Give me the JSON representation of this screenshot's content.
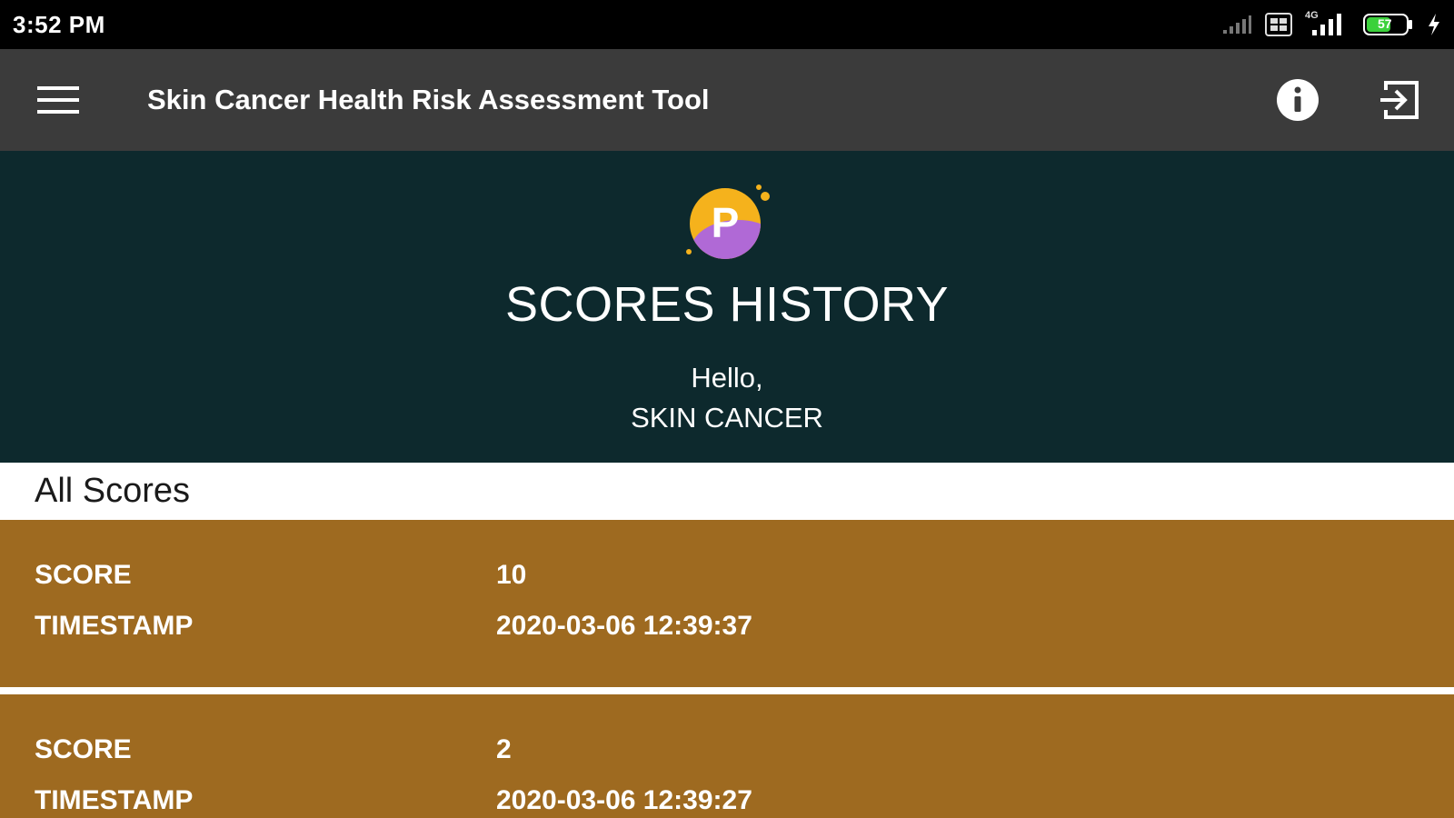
{
  "status_bar": {
    "time": "3:52 PM",
    "battery": "57",
    "network": "4G"
  },
  "app_bar": {
    "title": "Skin Cancer Health Risk Assessment Tool"
  },
  "hero": {
    "logo_letter": "P",
    "title": "SCORES HISTORY",
    "greeting": "Hello,",
    "user_name": "SKIN CANCER"
  },
  "section": {
    "title": "All Scores"
  },
  "scores": [
    {
      "score_label": "SCORE",
      "score": "10",
      "timestamp_label": "TIMESTAMP",
      "timestamp": "2020-03-06 12:39:37"
    },
    {
      "score_label": "SCORE",
      "score": "2",
      "timestamp_label": "TIMESTAMP",
      "timestamp": "2020-03-06 12:39:27"
    }
  ],
  "colors": {
    "status_bar": "#000000",
    "app_bar": "#3b3b3b",
    "hero_bg": "#0d292d",
    "card_bg": "#9e6a20",
    "logo_orange": "#f5b21c",
    "logo_purple": "#b069d6"
  }
}
